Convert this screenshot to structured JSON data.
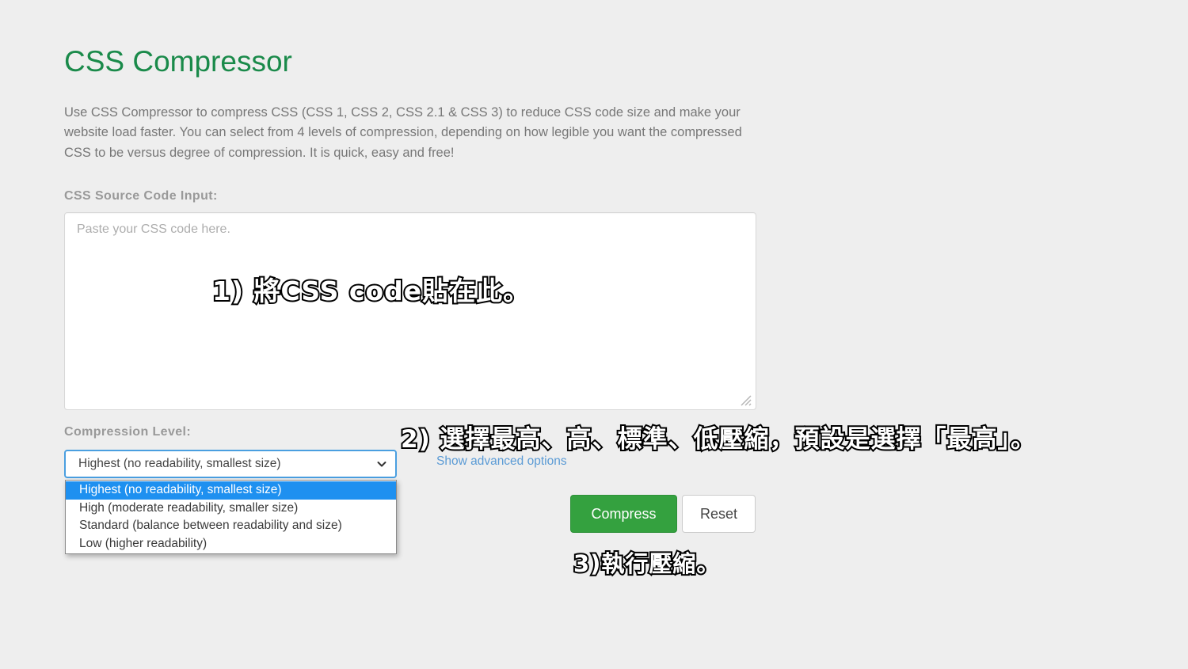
{
  "page": {
    "title": "CSS Compressor",
    "title_color": "#1a8a4a",
    "background_color": "#eeeeee",
    "intro": "Use CSS Compressor to compress CSS (CSS 1, CSS 2, CSS 2.1 & CSS 3) to reduce CSS code size and make your website load faster. You can select from 4 levels of compression, depending on how legible you want the compressed CSS to be versus degree of compression. It is quick, easy and free!"
  },
  "source_input": {
    "label": "CSS Source Code Input:",
    "placeholder": "Paste your CSS code here.",
    "value": "",
    "resize_grip_icon": "resize-grip-icon"
  },
  "compression": {
    "label": "Compression Level:",
    "selected_value": "Highest (no readability, smallest size)",
    "chevron_icon": "chevron-down-icon",
    "focus_border_color": "#4a9fe0",
    "highlight_color": "#1e90f0",
    "options": [
      "Highest (no readability, smallest size)",
      "High (moderate readability, smaller size)",
      "Standard (balance between readability and size)",
      "Low (higher readability)"
    ]
  },
  "advanced": {
    "link_label": "Show advanced options",
    "link_color": "#5b9bd5"
  },
  "actions": {
    "compress_label": "Compress",
    "compress_color": "#34a13f",
    "reset_label": "Reset"
  },
  "annotations": [
    {
      "id": "step-1",
      "text": "1) 將CSS code貼在此。"
    },
    {
      "id": "step-2",
      "text": "2) 選擇最高、高、標準、低壓縮，預設是選擇「最高」。"
    },
    {
      "id": "step-3",
      "text": "3)執行壓縮。"
    }
  ]
}
